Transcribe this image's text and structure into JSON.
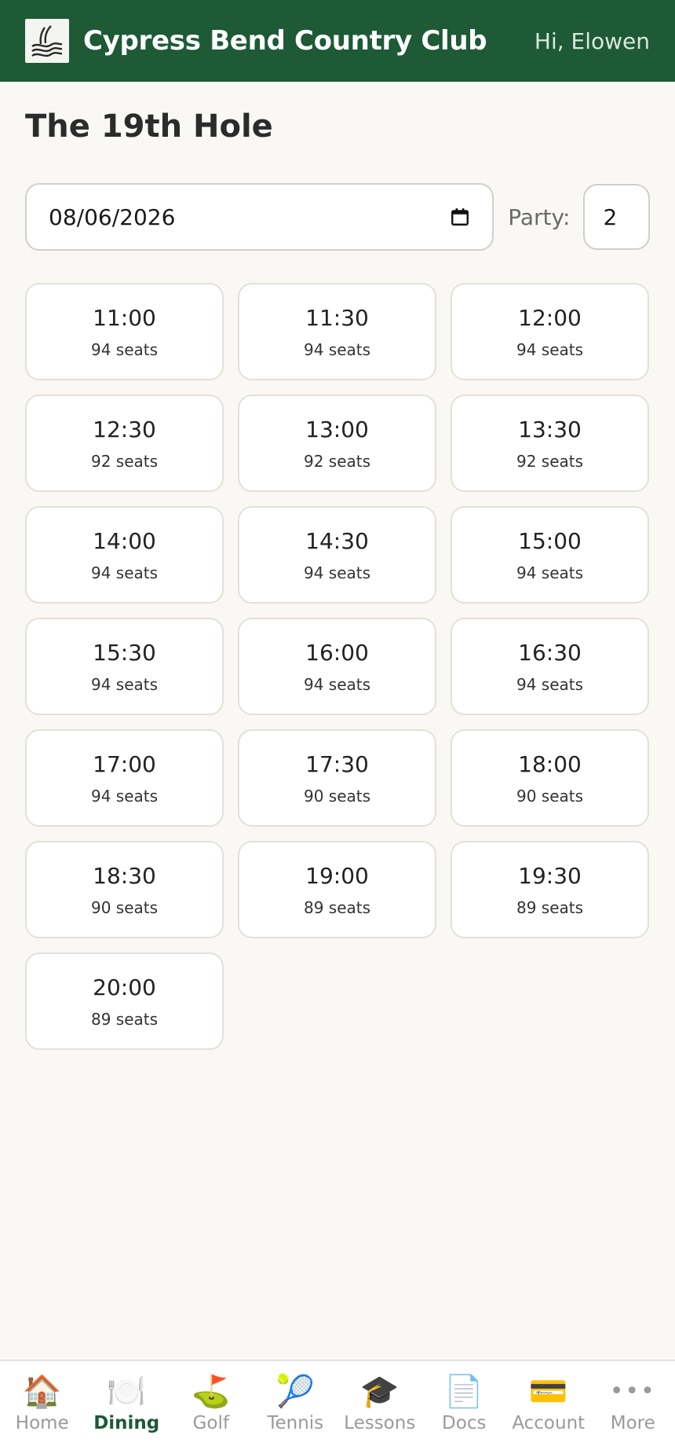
{
  "header": {
    "club_name": "Cypress Bend Country Club",
    "greeting": "Hi, Elowen",
    "brand_color": "#1d5a35"
  },
  "page": {
    "title": "The 19th Hole"
  },
  "filters": {
    "date_value": "08/06/2026",
    "party_label": "Party:",
    "party_value": "2"
  },
  "slots": [
    {
      "time": "11:00",
      "seats": "94 seats"
    },
    {
      "time": "11:30",
      "seats": "94 seats"
    },
    {
      "time": "12:00",
      "seats": "94 seats"
    },
    {
      "time": "12:30",
      "seats": "92 seats"
    },
    {
      "time": "13:00",
      "seats": "92 seats"
    },
    {
      "time": "13:30",
      "seats": "92 seats"
    },
    {
      "time": "14:00",
      "seats": "94 seats"
    },
    {
      "time": "14:30",
      "seats": "94 seats"
    },
    {
      "time": "15:00",
      "seats": "94 seats"
    },
    {
      "time": "15:30",
      "seats": "94 seats"
    },
    {
      "time": "16:00",
      "seats": "94 seats"
    },
    {
      "time": "16:30",
      "seats": "94 seats"
    },
    {
      "time": "17:00",
      "seats": "94 seats"
    },
    {
      "time": "17:30",
      "seats": "90 seats"
    },
    {
      "time": "18:00",
      "seats": "90 seats"
    },
    {
      "time": "18:30",
      "seats": "90 seats"
    },
    {
      "time": "19:00",
      "seats": "89 seats"
    },
    {
      "time": "19:30",
      "seats": "89 seats"
    },
    {
      "time": "20:00",
      "seats": "89 seats"
    }
  ],
  "tabs": [
    {
      "label": "Home",
      "icon": "house-icon",
      "glyph": "🏠",
      "active": false
    },
    {
      "label": "Dining",
      "icon": "plate-icon",
      "glyph": "🍽️",
      "active": true
    },
    {
      "label": "Golf",
      "icon": "golf-flag-icon",
      "glyph": "⛳",
      "active": false
    },
    {
      "label": "Tennis",
      "icon": "tennis-icon",
      "glyph": "🎾",
      "active": false
    },
    {
      "label": "Lessons",
      "icon": "graduation-cap-icon",
      "glyph": "🎓",
      "active": false
    },
    {
      "label": "Docs",
      "icon": "document-icon",
      "glyph": "📄",
      "active": false
    },
    {
      "label": "Account",
      "icon": "credit-card-icon",
      "glyph": "💳",
      "active": false
    },
    {
      "label": "More",
      "icon": "more-dots-icon",
      "glyph": "•••",
      "active": false
    }
  ]
}
